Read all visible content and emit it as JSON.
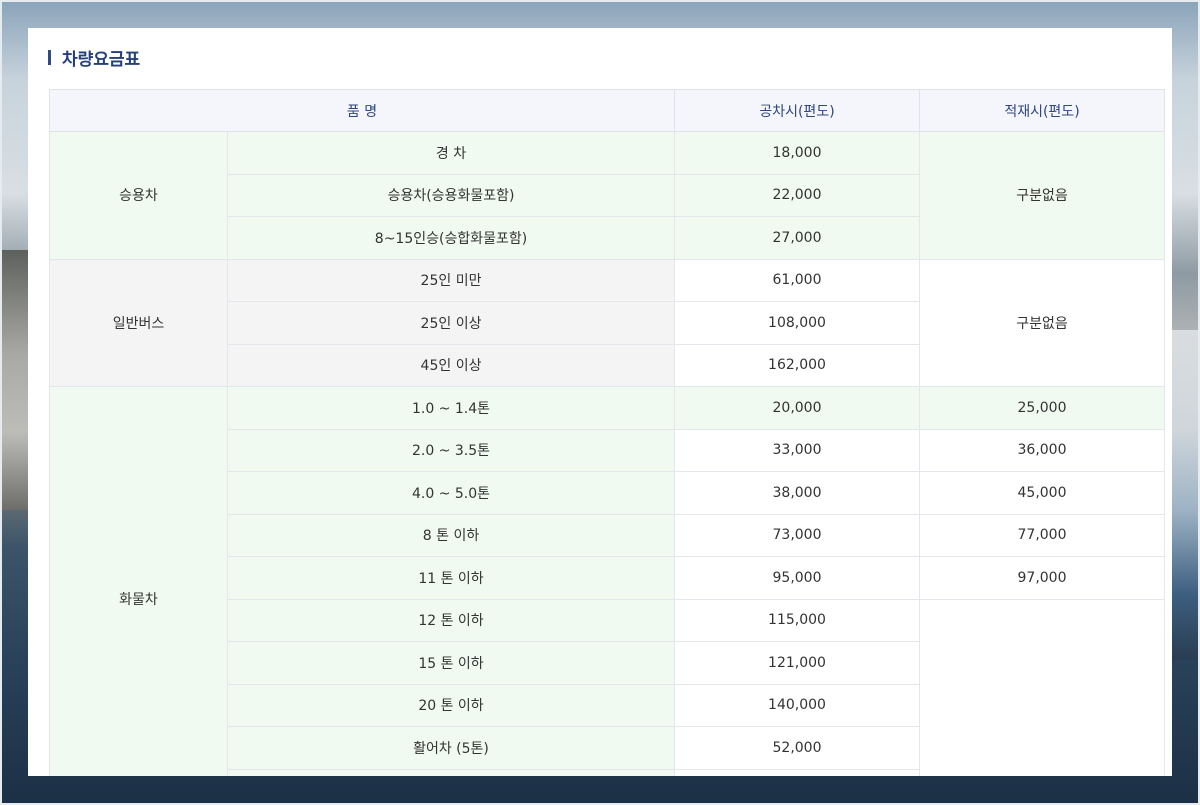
{
  "section_title": "차량요금표",
  "headers": {
    "item": "품 명",
    "empty": "공차시(편도)",
    "loaded": "적재시(편도)"
  },
  "groups": {
    "passenger": {
      "name": "승용차",
      "loaded_note": "구분없음"
    },
    "bus": {
      "name": "일반버스",
      "loaded_note": "구분없음"
    },
    "truck": {
      "name": "화물차"
    }
  },
  "rows": [
    {
      "type": "경 차",
      "empty": "18,000"
    },
    {
      "type": "승용차(승용화물포함)",
      "empty": "22,000"
    },
    {
      "type": "8~15인승(승합화물포함)",
      "empty": "27,000"
    },
    {
      "type": "25인 미만",
      "empty": "61,000"
    },
    {
      "type": "25인 이상",
      "empty": "108,000"
    },
    {
      "type": "45인 이상",
      "empty": "162,000"
    },
    {
      "type": "1.0 ~ 1.4톤",
      "empty": "20,000",
      "loaded": "25,000"
    },
    {
      "type": "2.0 ~ 3.5톤",
      "empty": "33,000",
      "loaded": "36,000"
    },
    {
      "type": "4.0 ~ 5.0톤",
      "empty": "38,000",
      "loaded": "45,000"
    },
    {
      "type": "8 톤 이하",
      "empty": "73,000",
      "loaded": "77,000"
    },
    {
      "type": "11 톤 이하",
      "empty": "95,000",
      "loaded": "97,000"
    },
    {
      "type": "12 톤 이하",
      "empty": "115,000"
    },
    {
      "type": "15 톤 이하",
      "empty": "121,000"
    },
    {
      "type": "20 톤 이하",
      "empty": "140,000"
    },
    {
      "type": "활어차 (5톤)",
      "empty": "52,000"
    },
    {
      "type": "",
      "empty": ""
    }
  ]
}
